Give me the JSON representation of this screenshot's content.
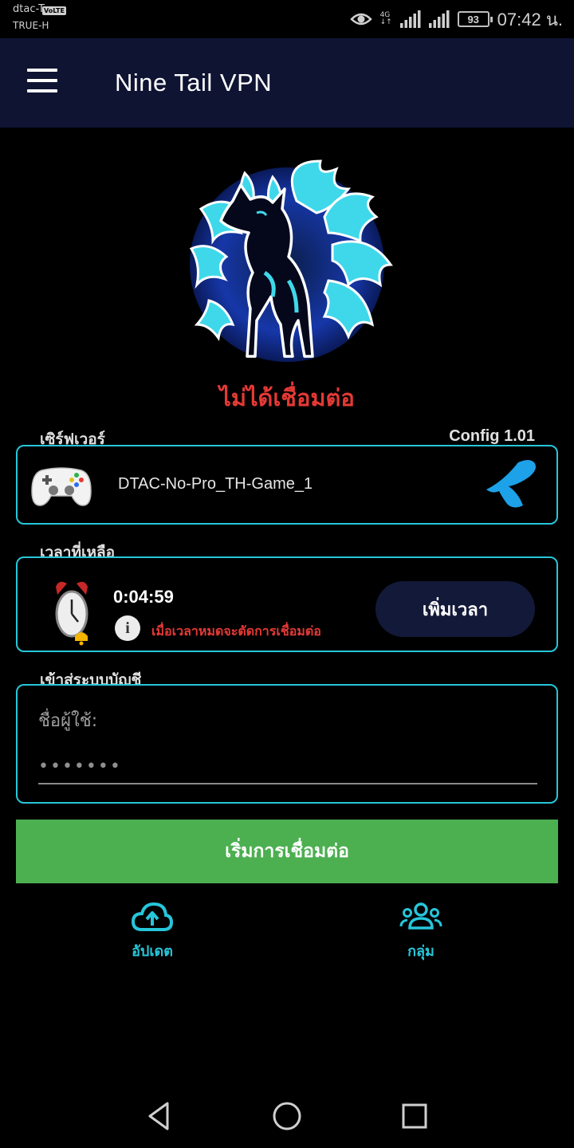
{
  "status_bar": {
    "carrier_primary": "dtac-T",
    "volte_badge": "VoLTE",
    "carrier_secondary": "TRUE-H",
    "network_type": "4G",
    "battery_level": "93",
    "time": "07:42 น.",
    "icons": [
      "eye-comfort-icon",
      "signal-icon",
      "battery-icon"
    ]
  },
  "app_bar": {
    "title": "Nine Tail VPN",
    "menu_icon": "hamburger-menu-icon"
  },
  "connection_status": "ไม่ได้เชื่อมต่อ",
  "server": {
    "section_label": "เซิร์ฟเวอร์",
    "config_label": "Config 1.01",
    "name": "DTAC-No-Pro_TH-Game_1",
    "left_icon": "gamepad-icon",
    "right_icon": "dtac-logo-icon"
  },
  "time_remaining": {
    "section_label": "เวลาที่เหลือ",
    "value": "0:04:59",
    "info_glyph": "i",
    "warning": "เมื่อเวลาหมดจะตัดการเชื่อมต่อ",
    "add_time_label": "เพิ่มเวลา",
    "icon": "alarm-clock-icon"
  },
  "login": {
    "section_label": "เข้าสู่ระบบบัญชี",
    "username_placeholder": "ชื่อผู้ใช้:",
    "password_placeholder": "•••••••"
  },
  "connect_button": "เริ่มการเชื่อมต่อ",
  "bottom_actions": [
    {
      "label": "อัปเดต",
      "icon": "cloud-upload-icon"
    },
    {
      "label": "กลุ่ม",
      "icon": "group-icon"
    }
  ],
  "colors": {
    "accent": "#26c6da",
    "app_bar": "#0f1433",
    "connect_green": "#4caf50",
    "status_red": "#e53935",
    "pill_navy": "#131938"
  }
}
